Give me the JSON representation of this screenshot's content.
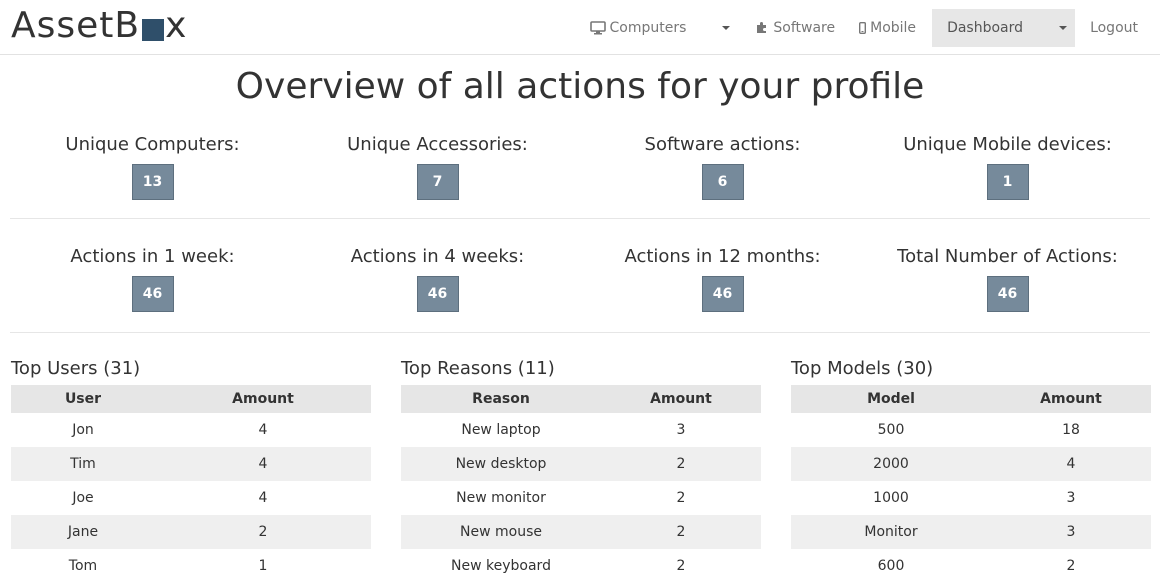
{
  "brand": {
    "text_before": "AssetB",
    "text_after": "x"
  },
  "nav": {
    "computers": "Computers",
    "software": "Software",
    "mobile": "Mobile",
    "dashboard": "Dashboard",
    "logout": "Logout",
    "icons": {
      "computers": "monitor-icon",
      "software": "puzzle-icon",
      "mobile": "mobile-icon"
    }
  },
  "page_title": "Overview of all actions for your profile",
  "stats_row1": [
    {
      "label": "Unique Computers:",
      "value": "13"
    },
    {
      "label": "Unique Accessories:",
      "value": "7"
    },
    {
      "label": "Software actions:",
      "value": "6"
    },
    {
      "label": "Unique Mobile devices:",
      "value": "1"
    }
  ],
  "stats_row2": [
    {
      "label": "Actions in 1 week:",
      "value": "46"
    },
    {
      "label": "Actions in 4 weeks:",
      "value": "46"
    },
    {
      "label": "Actions in 12 months:",
      "value": "46"
    },
    {
      "label": "Total Number of Actions:",
      "value": "46"
    }
  ],
  "tables": {
    "users": {
      "title": "Top Users (31)",
      "headers": [
        "User",
        "Amount"
      ],
      "rows": [
        [
          "Jon",
          "4"
        ],
        [
          "Tim",
          "4"
        ],
        [
          "Joe",
          "4"
        ],
        [
          "Jane",
          "2"
        ],
        [
          "Tom",
          "1"
        ]
      ]
    },
    "reasons": {
      "title": "Top Reasons (11)",
      "headers": [
        "Reason",
        "Amount"
      ],
      "rows": [
        [
          "New laptop",
          "3"
        ],
        [
          "New desktop",
          "2"
        ],
        [
          "New monitor",
          "2"
        ],
        [
          "New mouse",
          "2"
        ],
        [
          "New keyboard",
          "2"
        ]
      ]
    },
    "models": {
      "title": "Top Models (30)",
      "headers": [
        "Model",
        "Amount"
      ],
      "rows": [
        [
          "500",
          "18"
        ],
        [
          "2000",
          "4"
        ],
        [
          "1000",
          "3"
        ],
        [
          "Monitor",
          "3"
        ],
        [
          "600",
          "2"
        ]
      ]
    }
  },
  "colors": {
    "badge": "#768a9b",
    "brand_box": "#2f4f6a",
    "active_nav": "#e7e7e7",
    "table_header": "#e6e6e6"
  }
}
